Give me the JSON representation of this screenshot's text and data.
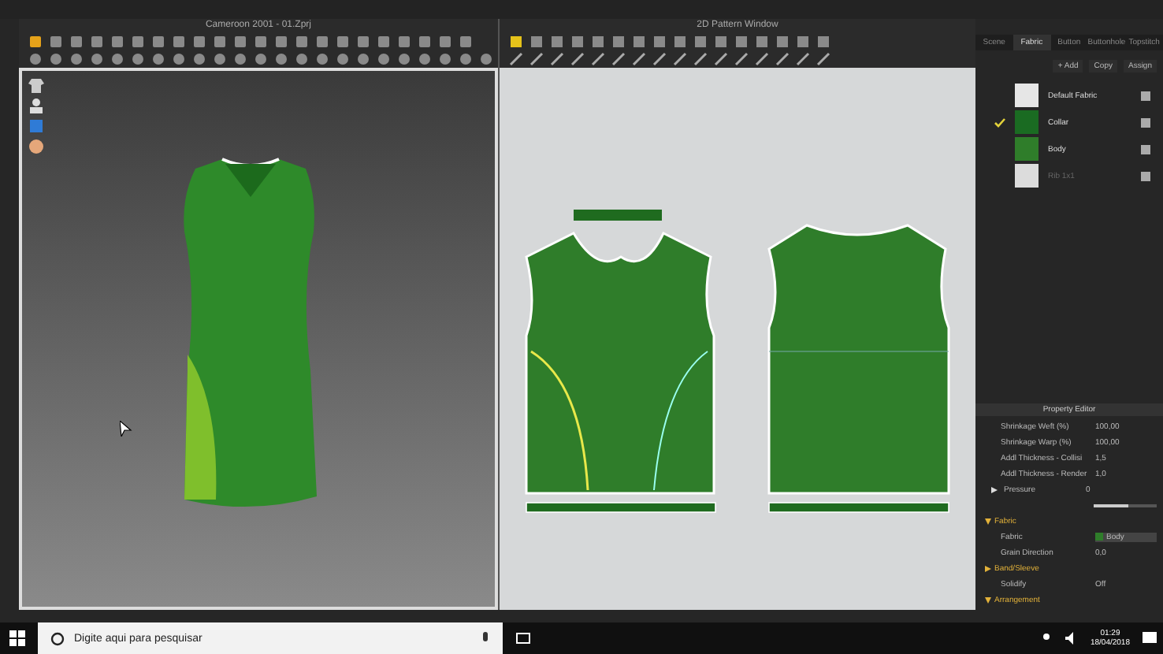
{
  "window_3d": {
    "title": "Cameroon 2001 - 01.Zprj"
  },
  "window_2d": {
    "title": "2D Pattern Window"
  },
  "object_browser": {
    "tabs": [
      {
        "label": "Scene",
        "selected": false
      },
      {
        "label": "Fabric",
        "selected": true
      },
      {
        "label": "Button",
        "selected": false
      },
      {
        "label": "Buttonhole",
        "selected": false
      },
      {
        "label": "Topstitch",
        "selected": false
      }
    ],
    "actions": [
      "+ Add",
      "Copy",
      "Assign"
    ],
    "fabrics": [
      {
        "name": "Default Fabric",
        "color": "#e6e6e6",
        "checked": false,
        "disabled": false
      },
      {
        "name": "Collar",
        "color": "#1a6b22",
        "checked": true,
        "disabled": false
      },
      {
        "name": "Body",
        "color": "#2f7d2a",
        "checked": false,
        "disabled": false
      },
      {
        "name": "Rib 1x1",
        "color": "#dcdcdc",
        "checked": false,
        "disabled": true
      }
    ]
  },
  "property_editor": {
    "title": "Property Editor",
    "rows": [
      {
        "kind": "value",
        "label": "Shrinkage Weft (%)",
        "value": "100,00"
      },
      {
        "kind": "value",
        "label": "Shrinkage Warp (%)",
        "value": "100,00"
      },
      {
        "kind": "value",
        "label": "Addl Thickness - Collisi",
        "value": "1,5"
      },
      {
        "kind": "value",
        "label": "Addl Thickness - Render",
        "value": "1,0"
      },
      {
        "kind": "slider",
        "label": "Pressure",
        "value": "0",
        "level": 0.55
      },
      {
        "kind": "section",
        "label": "Fabric",
        "expanded": true
      },
      {
        "kind": "swatch",
        "label": "Fabric",
        "value": "Body",
        "color": "#2f7d2a"
      },
      {
        "kind": "value",
        "label": "Grain Direction",
        "value": "0,0"
      },
      {
        "kind": "section",
        "label": "Band/Sleeve",
        "expanded": false
      },
      {
        "kind": "toggle",
        "label": "Solidify",
        "value": "Off"
      },
      {
        "kind": "section",
        "label": "Arrangement",
        "expanded": true
      }
    ]
  },
  "taskbar": {
    "search": {
      "placeholder": "Digite aqui para pesquisar"
    },
    "time": "01:29",
    "date": "18/04/2018"
  }
}
